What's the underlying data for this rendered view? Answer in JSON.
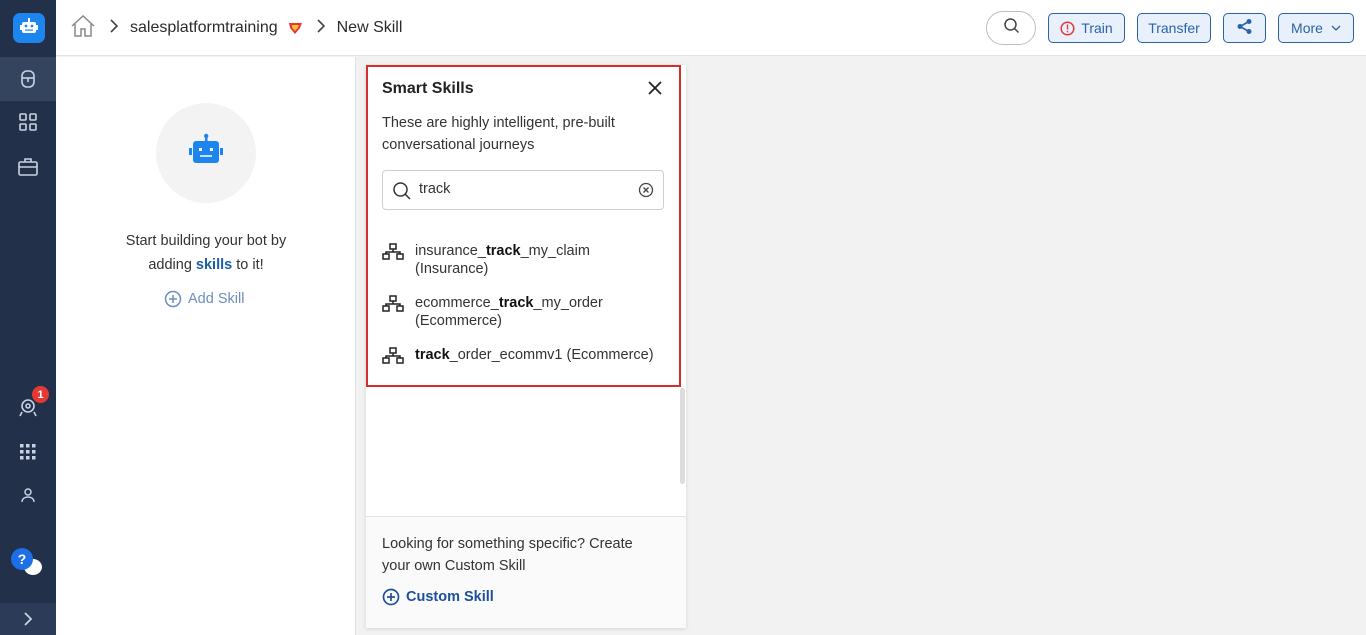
{
  "breadcrumb": {
    "bot_name": "salesplatformtraining",
    "current_page": "New Skill"
  },
  "header": {
    "train_label": "Train",
    "transfer_label": "Transfer",
    "more_label": "More"
  },
  "rail": {
    "notification_count": "1",
    "help_label": "?"
  },
  "empty_state": {
    "line1": "Start building your bot by",
    "line2_prefix": "adding ",
    "line2_link": "skills",
    "line2_suffix": " to it!",
    "add_skill_label": "Add Skill"
  },
  "smart_skills": {
    "title": "Smart Skills",
    "description": "These are highly intelligent, pre-built conversational journeys",
    "search_value": "track",
    "results": [
      {
        "prefix": "insurance_",
        "match": "track",
        "suffix": "_my_claim",
        "category": "(Insurance)"
      },
      {
        "prefix": "ecommerce_",
        "match": "track",
        "suffix": "_my_order",
        "category": "(Ecommerce)"
      },
      {
        "prefix": "",
        "match": "track",
        "suffix": "_order_ecommv1",
        "category": "(Ecommerce)"
      }
    ],
    "footer_text": "Looking for something specific? Create your own Custom Skill",
    "custom_skill_label": "Custom Skill"
  },
  "colors": {
    "rail_bg": "#22304a",
    "accent": "#1d86ee",
    "highlight_border": "#d32f2f",
    "button_blue": "#2a63a8"
  }
}
